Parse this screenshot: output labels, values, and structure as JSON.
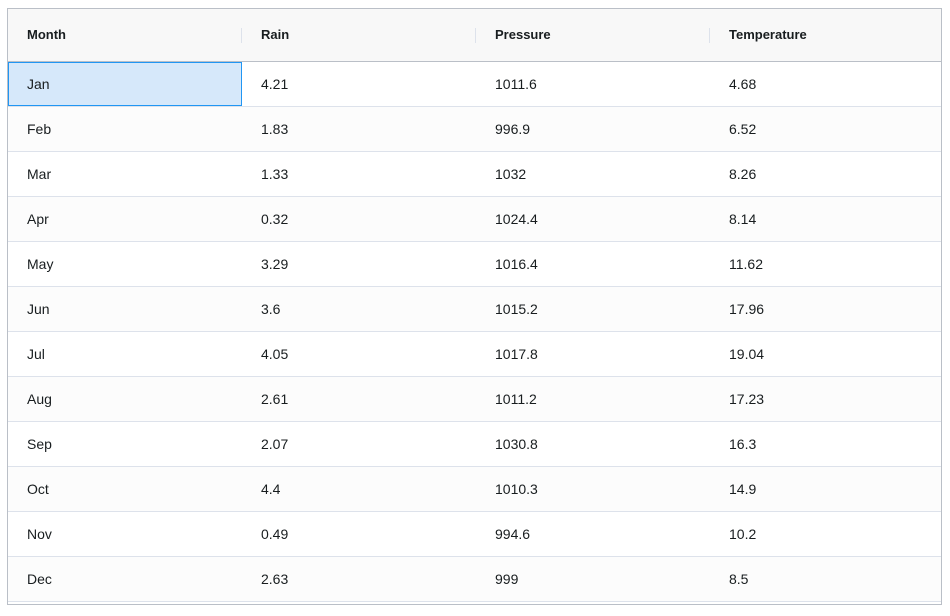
{
  "grid": {
    "columns": [
      "Month",
      "Rain",
      "Pressure",
      "Temperature"
    ],
    "rows": [
      [
        "Jan",
        "4.21",
        "1011.6",
        "4.68"
      ],
      [
        "Feb",
        "1.83",
        "996.9",
        "6.52"
      ],
      [
        "Mar",
        "1.33",
        "1032",
        "8.26"
      ],
      [
        "Apr",
        "0.32",
        "1024.4",
        "8.14"
      ],
      [
        "May",
        "3.29",
        "1016.4",
        "11.62"
      ],
      [
        "Jun",
        "3.6",
        "1015.2",
        "17.96"
      ],
      [
        "Jul",
        "4.05",
        "1017.8",
        "19.04"
      ],
      [
        "Aug",
        "2.61",
        "1011.2",
        "17.23"
      ],
      [
        "Sep",
        "2.07",
        "1030.8",
        "16.3"
      ],
      [
        "Oct",
        "4.4",
        "1010.3",
        "14.9"
      ],
      [
        "Nov",
        "0.49",
        "994.6",
        "10.2"
      ],
      [
        "Dec",
        "2.63",
        "999",
        "8.5"
      ]
    ],
    "focused_cell": {
      "row": 0,
      "col": 0
    },
    "colors": {
      "header_bg": "#f8f8f8",
      "border": "#babfc7",
      "row_border": "#dde2eb",
      "focus_bg": "#d6e8fa",
      "focus_border": "#2196f3"
    }
  }
}
